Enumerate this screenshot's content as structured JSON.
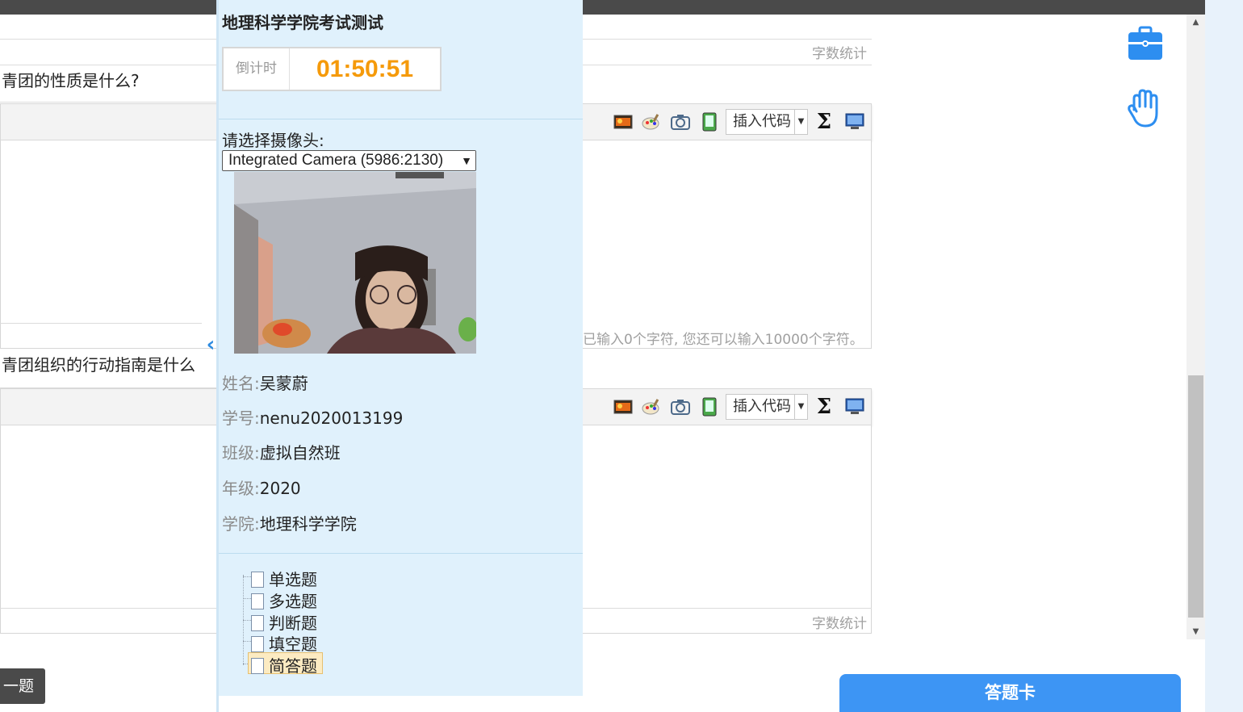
{
  "panel": {
    "title": "地理科学学院考试测试",
    "timer_label": "倒计时",
    "timer_value": "01:50:51",
    "camera_label": "请选择摄像头:",
    "camera_selected": "Integrated Camera (5986:2130)",
    "info": [
      {
        "key": "姓名:",
        "value": "吴蒙蔚"
      },
      {
        "key": "学号:",
        "value": "nenu2020013199"
      },
      {
        "key": "班级:",
        "value": "虚拟自然班"
      },
      {
        "key": "年级:",
        "value": "2020"
      },
      {
        "key": "学院:",
        "value": "地理科学学院"
      }
    ],
    "tree": [
      {
        "label": "单选题",
        "selected": false
      },
      {
        "label": "多选题",
        "selected": false
      },
      {
        "label": "判断题",
        "selected": false
      },
      {
        "label": "填空题",
        "selected": false
      },
      {
        "label": "简答题",
        "selected": true
      }
    ]
  },
  "questions": [
    {
      "text": "青团的性质是什么?"
    },
    {
      "text": "青团组织的行动指南是什么"
    }
  ],
  "editor": {
    "insert_code_label": "插入代码",
    "word_count_label": "字数统计",
    "char_count_text": "已输入0个字符, 您还可以输入10000个字符。"
  },
  "nav": {
    "prev_label": "一题",
    "answer_card_label": "答题卡"
  },
  "colors": {
    "accent": "#3d95f4",
    "timer": "#f59a0a",
    "panel_bg": "#e0f1fc"
  },
  "icons": [
    "image-icon",
    "paint-icon",
    "camera-icon",
    "phone-icon",
    "sigma-icon",
    "screen-icon",
    "toolbox-icon",
    "raise-hand-icon",
    "collapse-left-icon"
  ]
}
